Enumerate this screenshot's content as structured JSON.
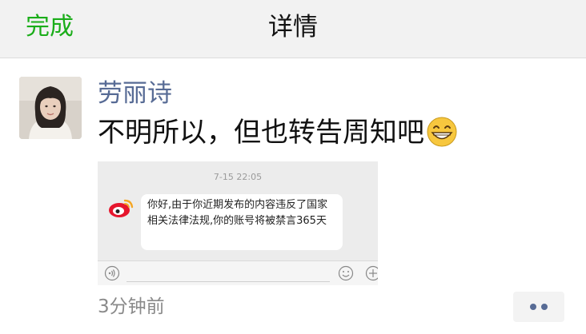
{
  "navbar": {
    "done_label": "完成",
    "title": "详情"
  },
  "post": {
    "author_name": "劳丽诗",
    "text": "不明所以，但也转告周知吧",
    "emoji": "grin-emoji",
    "time_ago": "3分钟前"
  },
  "screenshot": {
    "timestamp": "7-15 22:05",
    "message": "你好,由于你近期发布的内容违反了国家相关法律法规,你的账号将被禁言365天",
    "sender_icon": "weibo-icon"
  },
  "colors": {
    "accent_green": "#1aad19",
    "name_blue": "#576b95"
  }
}
